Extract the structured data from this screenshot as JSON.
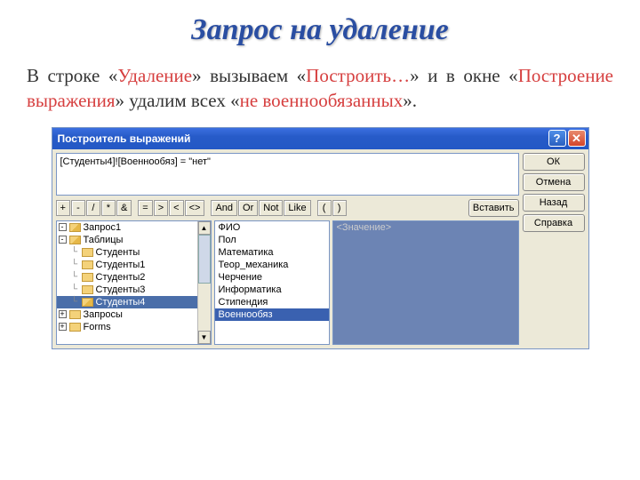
{
  "slide": {
    "title": "Запрос на удаление",
    "desc_parts": {
      "p1": "В строке «",
      "h1": "Удаление",
      "p2": "» вызываем «",
      "h2": "Построить…",
      "p3": "» и в окне «",
      "h3": "Построение выражения",
      "p4": "» удалим всех «",
      "h4": "не военнообязанных",
      "p5": "»."
    }
  },
  "dialog": {
    "title": "Построитель выражений",
    "expression": "[Студенты4]![Военнообяз] = \"нет\"",
    "buttons": {
      "ok": "ОК",
      "cancel": "Отмена",
      "back": "Назад",
      "help": "Справка",
      "insert": "Вставить"
    },
    "ops": [
      "+",
      "-",
      "/",
      "*",
      "&",
      "=",
      ">",
      "<",
      "<>",
      "And",
      "Or",
      "Not",
      "Like",
      "(",
      ")"
    ],
    "tree": [
      {
        "type": "folder-open",
        "label": "Запрос1",
        "box": "-"
      },
      {
        "type": "folder-open",
        "label": "Таблицы",
        "box": "-"
      },
      {
        "type": "folder-child",
        "label": "Студенты"
      },
      {
        "type": "folder-child",
        "label": "Студенты1"
      },
      {
        "type": "folder-child",
        "label": "Студенты2"
      },
      {
        "type": "folder-child",
        "label": "Студенты3"
      },
      {
        "type": "folder-child",
        "label": "Студенты4",
        "selected": true,
        "open": true
      },
      {
        "type": "folder-closed",
        "label": "Запросы",
        "box": "+"
      },
      {
        "type": "folder-closed",
        "label": "Forms",
        "box": "+"
      }
    ],
    "fields": [
      "ФИО",
      "Пол",
      "Математика",
      "Теор_механика",
      "Черчение",
      "Информатика",
      "Стипендия",
      "Военнообяз"
    ],
    "field_selected": "Военнообяз",
    "value_placeholder": "<Значение>",
    "help_glyph": "?",
    "close_glyph": "✕"
  }
}
